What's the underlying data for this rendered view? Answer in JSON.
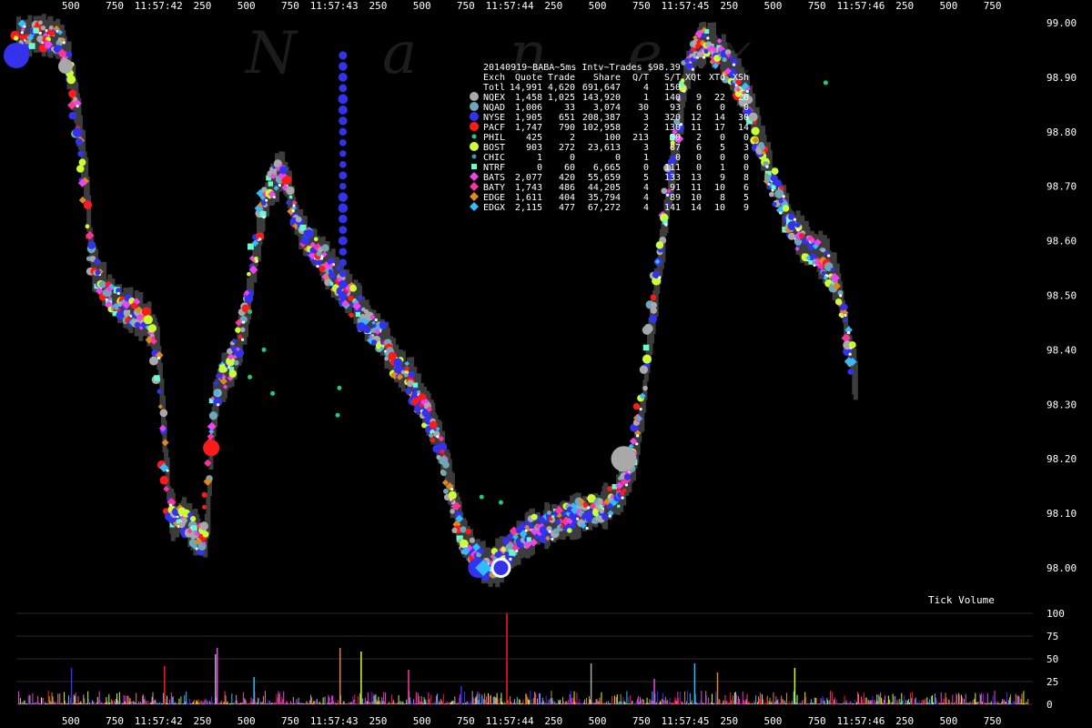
{
  "chart_data": {
    "type": "scatter",
    "title": "20140919~BABA~5ms Intv~Trades $98.39",
    "watermark": [
      "N",
      "a",
      "n",
      "e",
      "x"
    ],
    "x_tick_labels": [
      "500",
      "750",
      "11:57:42",
      "250",
      "500",
      "750",
      "11:57:43",
      "250",
      "500",
      "750",
      "11:57:44",
      "250",
      "500",
      "750",
      "11:57:45",
      "250",
      "500",
      "750",
      "11:57:46",
      "250",
      "500",
      "750"
    ],
    "x_tick_values": [
      0.5,
      0.75,
      1.0,
      1.25,
      1.5,
      1.75,
      2.0,
      2.25,
      2.5,
      2.75,
      3.0,
      3.25,
      3.5,
      3.75,
      4.0,
      4.25,
      4.5,
      4.75,
      5.0,
      5.25,
      5.5,
      5.75
    ],
    "xlim": [
      0.19,
      5.98
    ],
    "price_axis": {
      "ylim": [
        97.98,
        99.0
      ],
      "tick_labels": [
        "99.00",
        "98.90",
        "98.80",
        "98.70",
        "98.60",
        "98.50",
        "98.40",
        "98.30",
        "98.20",
        "98.10",
        "98.00"
      ],
      "tick_values": [
        99.0,
        98.9,
        98.8,
        98.7,
        98.6,
        98.5,
        98.4,
        98.3,
        98.2,
        98.1,
        98.0
      ]
    },
    "volume_axis": {
      "label": "Tick Volume",
      "ylim": [
        0,
        110
      ],
      "tick_labels": [
        "100",
        "75",
        "50",
        "25",
        "0"
      ],
      "tick_values": [
        100,
        75,
        50,
        25,
        0
      ]
    },
    "legend": {
      "position": "top-center",
      "columns": [
        "Exch",
        "Quote",
        "Trade",
        "Share",
        "Q/T",
        "S/T",
        "XQt",
        "XTd",
        "XSh"
      ],
      "total": [
        "Totl",
        "14,991",
        "4,620",
        "691,647",
        "4",
        "150",
        "",
        "",
        ""
      ],
      "rows": [
        {
          "name": "NQEX",
          "color": "#a9a9a9",
          "marker": "circle",
          "values": [
            "1,458",
            "1,025",
            "143,920",
            "1",
            "140",
            "9",
            "22",
            "20"
          ]
        },
        {
          "name": "NQAD",
          "color": "#6fa7b8",
          "marker": "circle",
          "values": [
            "1,006",
            "33",
            "3,074",
            "30",
            "93",
            "6",
            "0",
            "0"
          ]
        },
        {
          "name": "NYSE",
          "color": "#3333ee",
          "marker": "circle",
          "values": [
            "1,905",
            "651",
            "208,387",
            "3",
            "320",
            "12",
            "14",
            "30"
          ]
        },
        {
          "name": "PACF",
          "color": "#ff1a1a",
          "marker": "circle",
          "values": [
            "1,747",
            "790",
            "102,958",
            "2",
            "130",
            "11",
            "17",
            "14"
          ]
        },
        {
          "name": "PHIL",
          "color": "#22cc77",
          "marker": "circle",
          "values": [
            "425",
            "2",
            "100",
            "213",
            "50",
            "2",
            "0",
            "0"
          ]
        },
        {
          "name": "BOST",
          "color": "#ccff33",
          "marker": "circle",
          "values": [
            "903",
            "272",
            "23,613",
            "3",
            "87",
            "6",
            "5",
            "3"
          ]
        },
        {
          "name": "CHIC",
          "color": "#3399aa",
          "marker": "circle",
          "values": [
            "1",
            "0",
            "0",
            "1",
            "0",
            "0",
            "0",
            "0"
          ]
        },
        {
          "name": "NTRF",
          "color": "#66ffcc",
          "marker": "square",
          "values": [
            "0",
            "60",
            "6,665",
            "0",
            "111",
            "0",
            "1",
            "0"
          ]
        },
        {
          "name": "BATS",
          "color": "#ee44ee",
          "marker": "diamond",
          "values": [
            "2,077",
            "420",
            "55,659",
            "5",
            "133",
            "13",
            "9",
            "8"
          ]
        },
        {
          "name": "BATY",
          "color": "#ff3399",
          "marker": "diamond",
          "values": [
            "1,743",
            "486",
            "44,205",
            "4",
            "91",
            "11",
            "10",
            "6"
          ]
        },
        {
          "name": "EDGE",
          "color": "#dd8822",
          "marker": "diamond",
          "values": [
            "1,611",
            "404",
            "35,794",
            "4",
            "89",
            "10",
            "8",
            "5"
          ]
        },
        {
          "name": "EDGX",
          "color": "#33bbff",
          "marker": "diamond",
          "values": [
            "2,115",
            "477",
            "67,272",
            "4",
            "141",
            "14",
            "10",
            "9"
          ]
        }
      ]
    },
    "price_path": [
      [
        0.19,
        98.97
      ],
      [
        0.3,
        98.98
      ],
      [
        0.42,
        98.97
      ],
      [
        0.48,
        98.92
      ],
      [
        0.52,
        98.85
      ],
      [
        0.55,
        98.78
      ],
      [
        0.58,
        98.7
      ],
      [
        0.6,
        98.6
      ],
      [
        0.62,
        98.55
      ],
      [
        0.66,
        98.53
      ],
      [
        0.72,
        98.5
      ],
      [
        0.78,
        98.48
      ],
      [
        0.85,
        98.47
      ],
      [
        0.93,
        98.45
      ],
      [
        0.98,
        98.42
      ],
      [
        1.0,
        98.35
      ],
      [
        1.02,
        98.25
      ],
      [
        1.05,
        98.12
      ],
      [
        1.08,
        98.08
      ],
      [
        1.13,
        98.1
      ],
      [
        1.18,
        98.07
      ],
      [
        1.22,
        98.06
      ],
      [
        1.25,
        98.04
      ],
      [
        1.27,
        98.1
      ],
      [
        1.29,
        98.22
      ],
      [
        1.31,
        98.3
      ],
      [
        1.33,
        98.33
      ],
      [
        1.36,
        98.35
      ],
      [
        1.42,
        98.38
      ],
      [
        1.48,
        98.45
      ],
      [
        1.53,
        98.55
      ],
      [
        1.58,
        98.65
      ],
      [
        1.63,
        98.7
      ],
      [
        1.69,
        98.73
      ],
      [
        1.73,
        98.7
      ],
      [
        1.78,
        98.63
      ],
      [
        1.84,
        98.6
      ],
      [
        1.9,
        98.58
      ],
      [
        1.96,
        98.55
      ],
      [
        2.03,
        98.52
      ],
      [
        2.08,
        98.5
      ],
      [
        2.13,
        98.48
      ],
      [
        2.18,
        98.45
      ],
      [
        2.25,
        98.43
      ],
      [
        2.3,
        98.4
      ],
      [
        2.35,
        98.37
      ],
      [
        2.42,
        98.35
      ],
      [
        2.5,
        98.3
      ],
      [
        2.57,
        98.25
      ],
      [
        2.62,
        98.2
      ],
      [
        2.67,
        98.12
      ],
      [
        2.72,
        98.06
      ],
      [
        2.8,
        98.02
      ],
      [
        2.88,
        98.0
      ],
      [
        2.96,
        98.02
      ],
      [
        3.05,
        98.05
      ],
      [
        3.13,
        98.07
      ],
      [
        3.22,
        98.08
      ],
      [
        3.32,
        98.09
      ],
      [
        3.42,
        98.1
      ],
      [
        3.52,
        98.11
      ],
      [
        3.6,
        98.13
      ],
      [
        3.7,
        98.2
      ],
      [
        3.75,
        98.3
      ],
      [
        3.78,
        98.4
      ],
      [
        3.82,
        98.5
      ],
      [
        3.86,
        98.6
      ],
      [
        3.9,
        98.7
      ],
      [
        3.95,
        98.8
      ],
      [
        3.99,
        98.9
      ],
      [
        4.05,
        98.95
      ],
      [
        4.12,
        98.97
      ],
      [
        4.2,
        98.94
      ],
      [
        4.28,
        98.9
      ],
      [
        4.36,
        98.85
      ],
      [
        4.42,
        98.78
      ],
      [
        4.5,
        98.7
      ],
      [
        4.58,
        98.64
      ],
      [
        4.66,
        98.6
      ],
      [
        4.74,
        98.58
      ],
      [
        4.8,
        98.56
      ],
      [
        4.86,
        98.52
      ],
      [
        4.9,
        98.45
      ],
      [
        4.94,
        98.38
      ],
      [
        4.96,
        98.34
      ]
    ],
    "highlights": [
      {
        "exchange": "NYSE",
        "x": 0.19,
        "y": 98.94,
        "size": 14
      },
      {
        "exchange": "NQEX",
        "x": 0.47,
        "y": 98.92,
        "size": 8
      },
      {
        "exchange": "PACF",
        "x": 1.3,
        "y": 98.22,
        "size": 9
      },
      {
        "exchange": "NQEX",
        "x": 3.65,
        "y": 98.2,
        "size": 14
      },
      {
        "exchange": "NYSE",
        "x": 2.82,
        "y": 98.0,
        "size": 11
      },
      {
        "exchange": "EDGX",
        "x": 2.85,
        "y": 98.0,
        "size": 9
      },
      {
        "exchange": "NQAD",
        "x": 2.95,
        "y": 98.0,
        "size": 11
      }
    ],
    "phil_quotes": [
      [
        1.52,
        98.47
      ],
      [
        1.6,
        98.4
      ],
      [
        1.52,
        98.35
      ],
      [
        1.65,
        98.32
      ],
      [
        2.03,
        98.33
      ],
      [
        2.02,
        98.28
      ],
      [
        2.84,
        98.13
      ],
      [
        2.95,
        98.12
      ],
      [
        4.8,
        98.89
      ]
    ],
    "nyse_column": {
      "x": 2.05,
      "y_from": 98.5,
      "y_to": 98.95
    },
    "volume_spikes": [
      [
        0.5,
        40
      ],
      [
        1.03,
        42
      ],
      [
        1.32,
        55
      ],
      [
        1.33,
        62
      ],
      [
        1.54,
        30
      ],
      [
        2.03,
        62
      ],
      [
        2.15,
        58
      ],
      [
        2.42,
        38
      ],
      [
        2.72,
        20
      ],
      [
        2.98,
        100
      ],
      [
        3.46,
        45
      ],
      [
        3.82,
        28
      ],
      [
        4.05,
        45
      ],
      [
        4.18,
        35
      ],
      [
        4.62,
        40
      ]
    ]
  }
}
